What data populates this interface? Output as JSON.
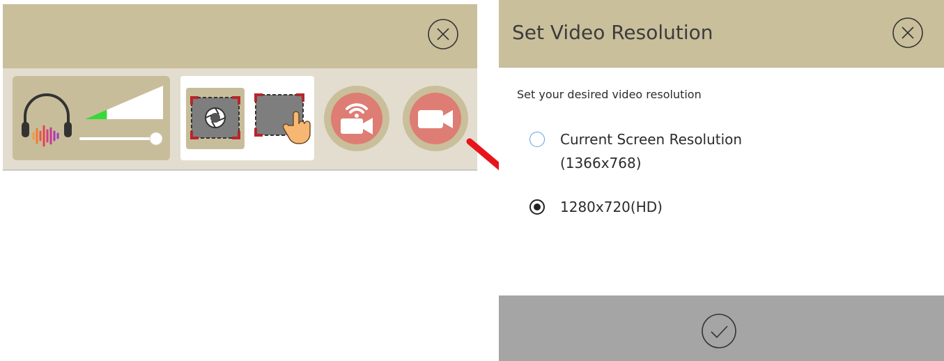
{
  "toolbar": {
    "icons": {
      "close": "close-circle-icon",
      "headphones": "headphones-icon",
      "volume": "volume-level-icon",
      "slider": "volume-slider",
      "full_capture": "fullscreen-capture-icon",
      "region_capture": "region-capture-icon",
      "stream": "stream-camera-icon",
      "record": "record-camera-icon"
    },
    "volume_level": 0.28,
    "colors": {
      "header": "#c9bf9b",
      "body": "#e2ddcf",
      "button_red": "#de7d74",
      "level_green": "#37d837"
    }
  },
  "dialog": {
    "title": "Set Video Resolution",
    "subtitle": "Set your desired video resolution",
    "options": [
      {
        "label_line1": "Current Screen Resolution",
        "label_line2": "(1366x768)",
        "selected": false
      },
      {
        "label_line1": "1280x720(HD)",
        "selected": true
      }
    ],
    "confirm_icon": "checkmark-circle-icon",
    "close_icon": "close-circle-icon",
    "colors": {
      "header": "#c9bf9b",
      "footer": "#a5a5a5"
    }
  },
  "annotation": {
    "arrow_color": "#e8141b",
    "arrow_icon": "red-arrow-icon"
  }
}
